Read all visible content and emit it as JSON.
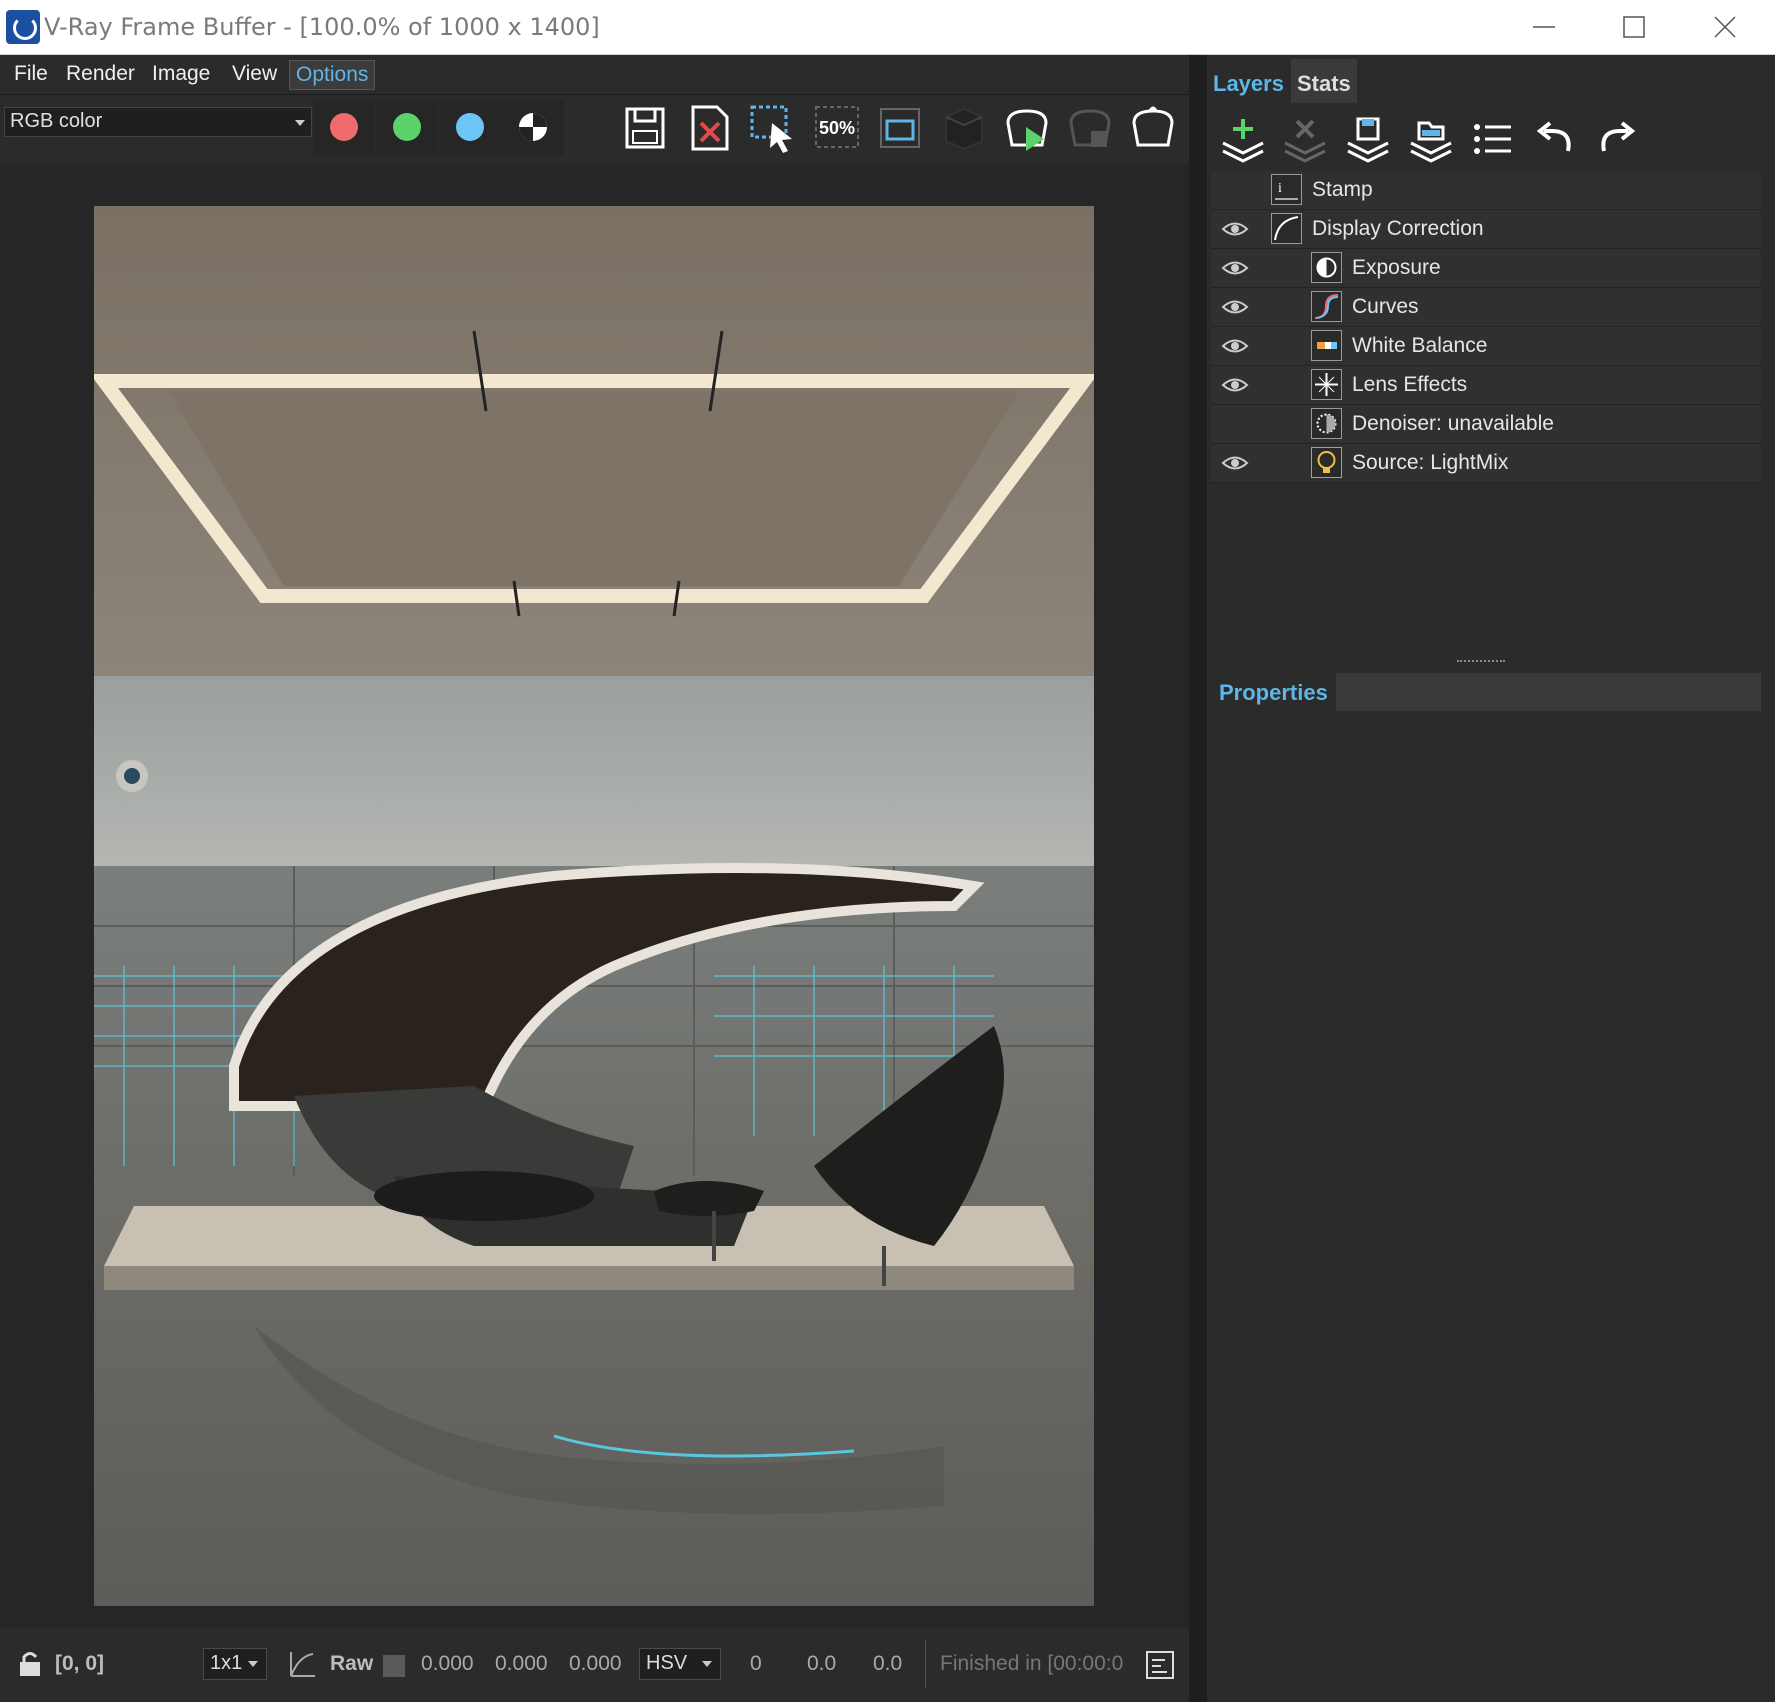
{
  "window": {
    "title": "V-Ray Frame Buffer - [100.0% of 1000 x 1400]",
    "minimize_icon": "minimize-icon",
    "maximize_icon": "maximize-icon",
    "close_icon": "close-icon"
  },
  "menu": {
    "items": [
      "File",
      "Render",
      "Image",
      "View",
      "Options"
    ],
    "active": "Options"
  },
  "toolbar": {
    "channel": "RGB color",
    "channels": [
      {
        "name": "red-channel",
        "color": "#f06b6b"
      },
      {
        "name": "green-channel",
        "color": "#5bd36a"
      },
      {
        "name": "blue-channel",
        "color": "#6cc5f5"
      }
    ],
    "zoom_label": "50%",
    "icons": [
      "save-icon",
      "clear-icon",
      "region-render-icon",
      "zoom-50-icon",
      "fit-icon",
      "3d-icon",
      "start-interactive-icon",
      "stop-interactive-icon",
      "render-teapot-icon"
    ]
  },
  "status": {
    "coords": "[0, 0]",
    "sample_size": "1x1",
    "mode": "Raw",
    "r": "0.000",
    "g": "0.000",
    "b": "0.000",
    "color_space": "HSV",
    "h": "0",
    "s": "0.0",
    "v": "0.0",
    "message": "Finished in [00:00:0"
  },
  "panel": {
    "tabs": [
      "Layers",
      "Stats"
    ],
    "active_tab": "Layers",
    "layer_tools": [
      "add-layer-icon",
      "remove-layer-icon",
      "save-layers-icon",
      "load-layers-icon",
      "layer-list-icon",
      "undo-icon",
      "redo-icon"
    ],
    "layers": [
      {
        "name": "Stamp",
        "visible": false,
        "icon": "stamp-icon",
        "indent": 0
      },
      {
        "name": "Display Correction",
        "visible": true,
        "icon": "display-correction-icon",
        "indent": 0
      },
      {
        "name": "Exposure",
        "visible": true,
        "icon": "exposure-icon",
        "indent": 1
      },
      {
        "name": "Curves",
        "visible": true,
        "icon": "curves-icon",
        "indent": 1
      },
      {
        "name": "White Balance",
        "visible": true,
        "icon": "white-balance-icon",
        "indent": 1
      },
      {
        "name": "Lens Effects",
        "visible": true,
        "icon": "lens-effects-icon",
        "indent": 1
      },
      {
        "name": "Denoiser: unavailable",
        "visible": false,
        "icon": "denoiser-icon",
        "indent": 1
      },
      {
        "name": "Source: LightMix",
        "visible": true,
        "icon": "lightmix-icon",
        "indent": 1
      }
    ],
    "properties_label": "Properties"
  },
  "colors": {
    "accent": "#5eb6e8",
    "background": "#2b2b2b",
    "viewport": "#262626"
  }
}
